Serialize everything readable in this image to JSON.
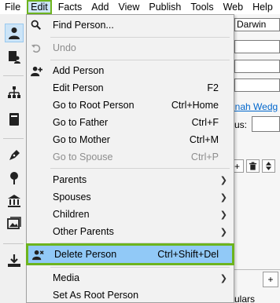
{
  "menubar": {
    "items": [
      "File",
      "Edit",
      "Facts",
      "Add",
      "View",
      "Publish",
      "Tools",
      "Web",
      "Help"
    ]
  },
  "toolbar": {
    "icons": [
      "person-icon",
      "people-book-icon",
      "family-tree-icon",
      "book-icon",
      "pen-icon",
      "map-pin-icon",
      "bank-icon",
      "photos-icon",
      "download-icon"
    ]
  },
  "background": {
    "surname_value": "Darwin",
    "link_text": "nnah Wedg",
    "status_label": "us:",
    "bottom_text": "ulars",
    "add_symbol": "+",
    "del_symbol": "🗑",
    "sort_symbol": "⇕"
  },
  "edit_menu": {
    "items": [
      {
        "label": "Find Person...",
        "shortcut": "",
        "icon": "search-icon",
        "enabled": true,
        "submenu": false
      },
      {
        "label": "Undo",
        "shortcut": "",
        "icon": "undo-icon",
        "enabled": false,
        "submenu": false
      },
      {
        "label": "Add Person",
        "shortcut": "",
        "icon": "add-person-icon",
        "enabled": true,
        "submenu": false
      },
      {
        "label": "Edit Person",
        "shortcut": "F2",
        "icon": "",
        "enabled": true,
        "submenu": false
      },
      {
        "label": "Go to Root Person",
        "shortcut": "Ctrl+Home",
        "icon": "",
        "enabled": true,
        "submenu": false
      },
      {
        "label": "Go to Father",
        "shortcut": "Ctrl+F",
        "icon": "",
        "enabled": true,
        "submenu": false
      },
      {
        "label": "Go to Mother",
        "shortcut": "Ctrl+M",
        "icon": "",
        "enabled": true,
        "submenu": false
      },
      {
        "label": "Go to Spouse",
        "shortcut": "Ctrl+P",
        "icon": "",
        "enabled": false,
        "submenu": false
      },
      {
        "label": "Parents",
        "shortcut": "",
        "icon": "",
        "enabled": true,
        "submenu": true
      },
      {
        "label": "Spouses",
        "shortcut": "",
        "icon": "",
        "enabled": true,
        "submenu": true
      },
      {
        "label": "Children",
        "shortcut": "",
        "icon": "",
        "enabled": true,
        "submenu": true
      },
      {
        "label": "Other Parents",
        "shortcut": "",
        "icon": "",
        "enabled": true,
        "submenu": true
      },
      {
        "label": "Delete Person",
        "shortcut": "Ctrl+Shift+Del",
        "icon": "delete-person-icon",
        "enabled": true,
        "submenu": false,
        "highlighted": true
      },
      {
        "label": "Media",
        "shortcut": "",
        "icon": "",
        "enabled": true,
        "submenu": true
      },
      {
        "label": "Set As Root Person",
        "shortcut": "",
        "icon": "",
        "enabled": true,
        "submenu": false
      }
    ]
  },
  "colors": {
    "highlight_fill": "#91c9f7",
    "highlight_border": "#6db41e",
    "link": "#0066cc"
  }
}
